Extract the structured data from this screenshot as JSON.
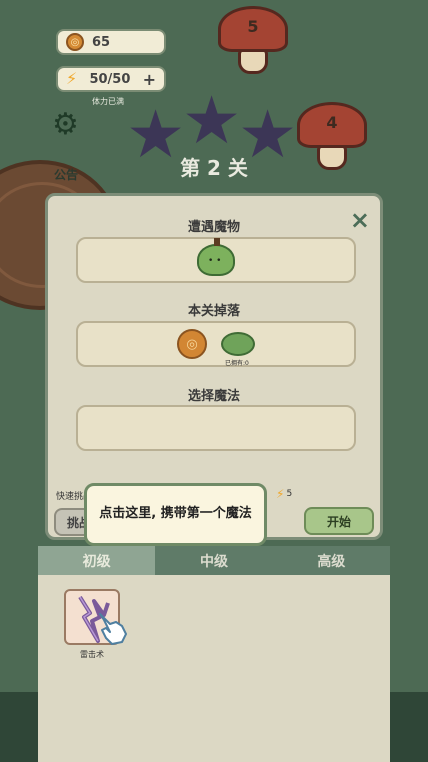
{
  "resources": {
    "coins": "65",
    "stamina": "50/50",
    "stamina_note": "体力已满",
    "plus": "+"
  },
  "notice_label": "公告",
  "level": {
    "title": "第 2 关",
    "stars_earned": 0,
    "stars_total": 3
  },
  "map_mushrooms": [
    "5",
    "4"
  ],
  "dialog": {
    "encounter_title": "遭遇魔物",
    "drops_title": "本关掉落",
    "drop_owned": "已拥有:0",
    "magic_title": "选择魔法",
    "quick_challenge_prefix": "快速挑战",
    "challenge_button": "挑战",
    "energy_cost": "5",
    "start_button": "开始",
    "close_label": "×"
  },
  "tooltip": "点击这里, 携带第一个魔法",
  "tabs": [
    {
      "label": "初级",
      "active": true
    },
    {
      "label": "中级",
      "active": false
    },
    {
      "label": "高级",
      "active": false
    }
  ],
  "spells": [
    {
      "name": "雷击术",
      "icon": "lightning-icon"
    }
  ],
  "colors": {
    "accent": "#7d8d78",
    "panel": "#dcd8c4",
    "star_empty": "#3c3656"
  }
}
